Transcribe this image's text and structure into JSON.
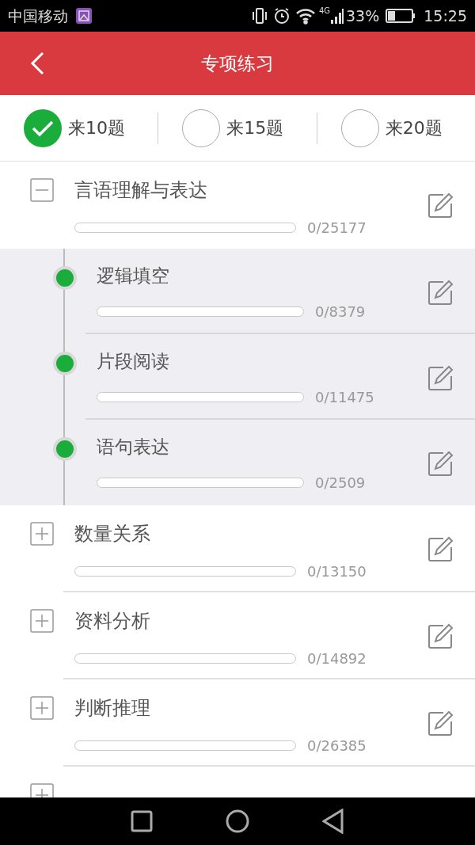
{
  "status_bar": {
    "carrier": "中国移动",
    "network": "4G",
    "battery": "33%",
    "time": "15:25"
  },
  "header": {
    "title": "专项练习"
  },
  "options": [
    {
      "label": "来10题",
      "selected": true
    },
    {
      "label": "来15题",
      "selected": false
    },
    {
      "label": "来20题",
      "selected": false
    }
  ],
  "categories": [
    {
      "title": "言语理解与表达",
      "level": 0,
      "reading": "0/25177",
      "expanded": true,
      "children": [
        {
          "title": "逻辑填空",
          "level": 0,
          "reading": "0/8379"
        },
        {
          "title": "片段阅读",
          "level": 0,
          "reading": "0/11475"
        },
        {
          "title": "语句表达",
          "level": 0,
          "reading": "0/2509"
        }
      ]
    },
    {
      "title": "数量关系",
      "level": 0,
      "reading": "0/13150",
      "expanded": false
    },
    {
      "title": "资料分析",
      "level": 0,
      "reading": "0/14892",
      "expanded": false
    },
    {
      "title": "判断推理",
      "level": 0,
      "reading": "0/26385",
      "expanded": false
    },
    {
      "expanded": false
    }
  ]
}
